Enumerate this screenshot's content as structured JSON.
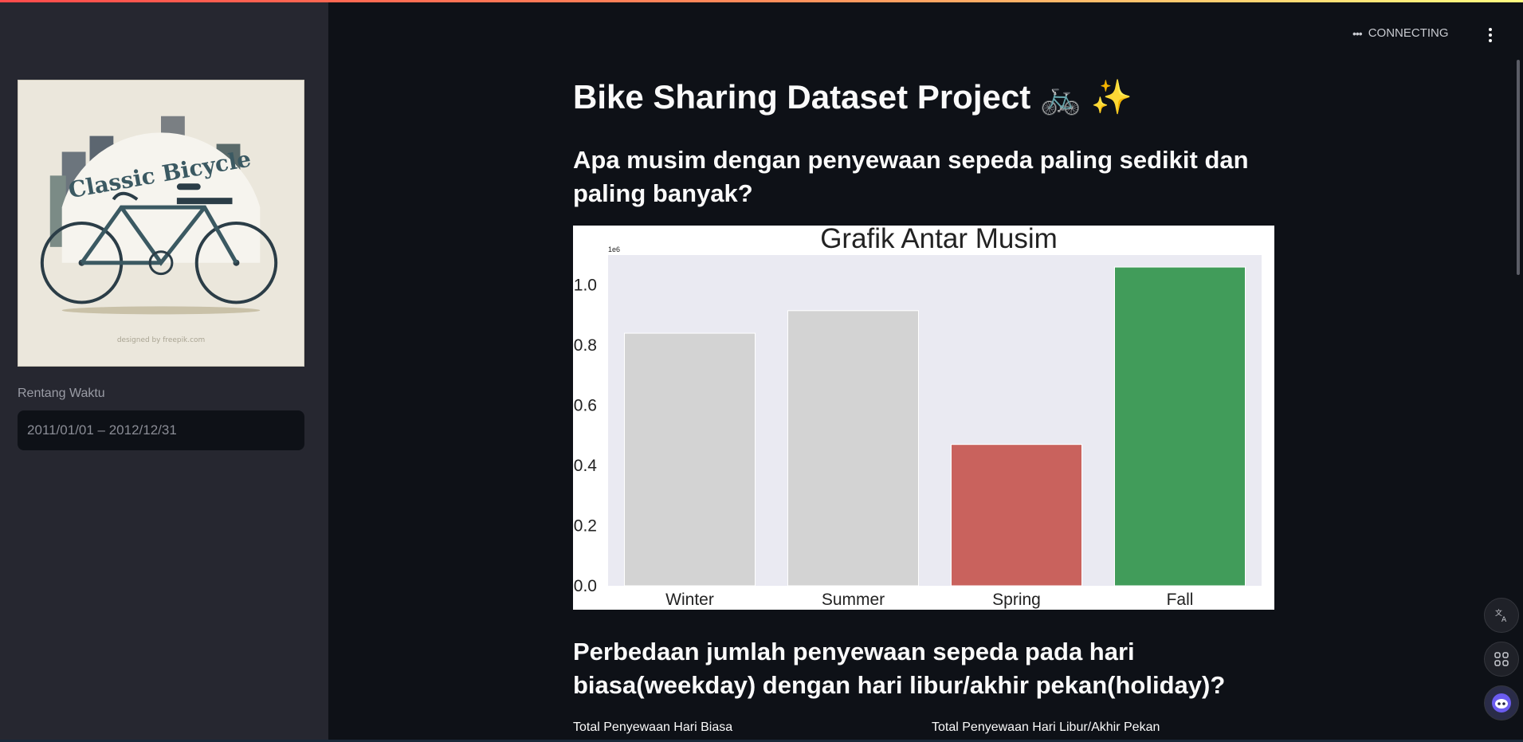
{
  "status": {
    "text": "CONNECTING"
  },
  "sidebar": {
    "image": {
      "title": "Classic Bicycle",
      "credit": "designed by freepik.com"
    },
    "date_range": {
      "label": "Rentang Waktu",
      "value": "2011/01/01 – 2012/12/31"
    }
  },
  "main": {
    "title": "Bike Sharing Dataset Project 🚲 ✨",
    "heading_1": "Apa musim dengan penyewaan sepeda paling sedikit dan paling banyak?",
    "heading_2": "Perbedaan jumlah penyewaan sepeda pada hari biasa(weekday) dengan hari libur/akhir pekan(holiday)?",
    "metric_labels": [
      "Total Penyewaan Hari Biasa",
      "Total Penyewaan Hari Libur/Akhir Pekan"
    ]
  },
  "chart_data": {
    "type": "bar",
    "title": "Grafik Antar Musim",
    "categories": [
      "Winter",
      "Summer",
      "Spring",
      "Fall"
    ],
    "values": [
      840000,
      915000,
      470000,
      1060000
    ],
    "colors": [
      "#d3d3d3",
      "#d3d3d3",
      "#c9625d",
      "#419c5a"
    ],
    "scale_label": "1e6",
    "yticks": [
      "0.0",
      "0.2",
      "0.4",
      "0.6",
      "0.8",
      "1.0"
    ],
    "ylim": [
      0,
      1100000
    ],
    "grid": false
  },
  "colors": {
    "background": "#0e1117",
    "sidebar": "#262730",
    "plot_background": "#eaeaf2"
  },
  "icons": {
    "menu": "vertical-ellipsis-icon",
    "translate": "translate-icon",
    "apps": "apps-icon",
    "assistant": "assistant-icon"
  }
}
